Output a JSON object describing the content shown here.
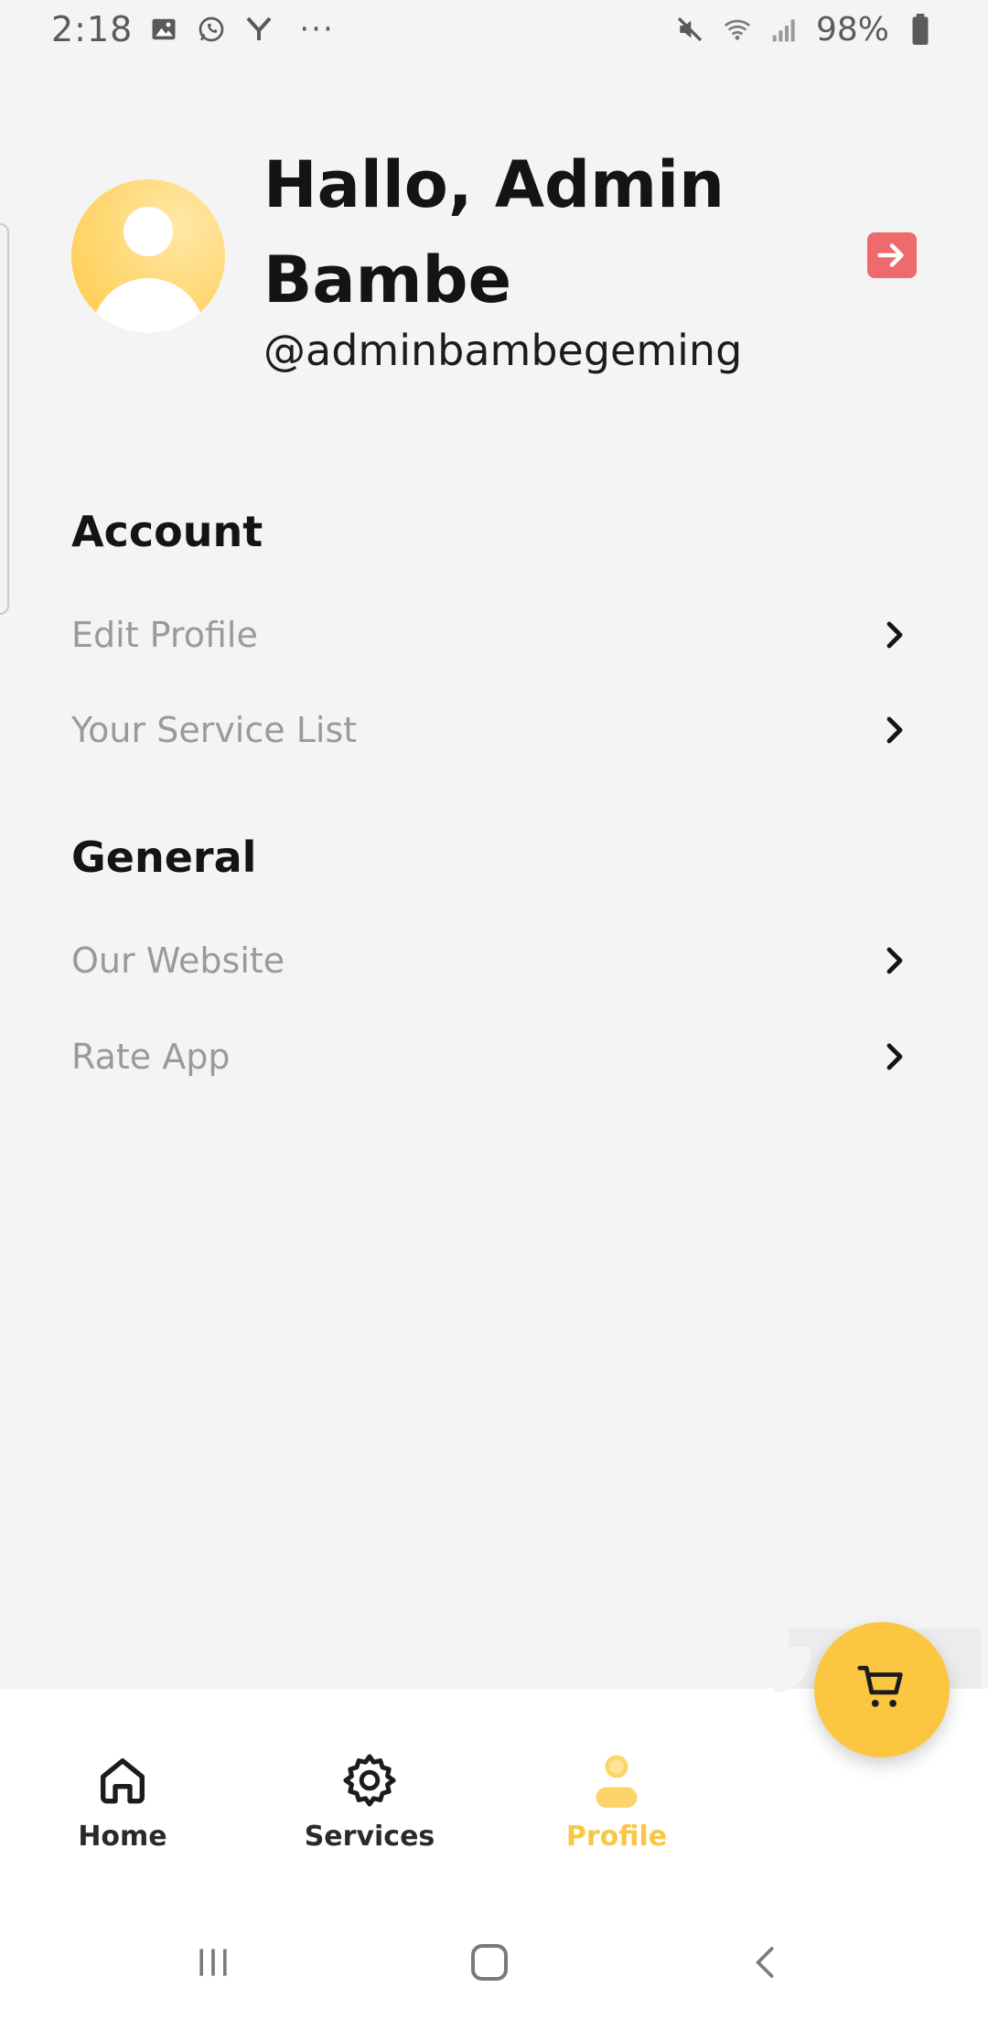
{
  "status_bar": {
    "time": "2:18",
    "left_icons": [
      "image-icon",
      "whatsapp-icon",
      "y-app-icon"
    ],
    "more": "···",
    "right_icons": [
      "mute-icon",
      "wifi-icon",
      "signal-icon"
    ],
    "battery": "98%"
  },
  "profile": {
    "greeting": "Hallo, Admin Bambe",
    "username": "@adminbambegeming",
    "accent_color": "#ffd56a",
    "logout_color": "#ef6a6a"
  },
  "sections": [
    {
      "title": "Account",
      "items": [
        {
          "label": "Edit Profile"
        },
        {
          "label": "Your Service List"
        }
      ]
    },
    {
      "title": "General",
      "items": [
        {
          "label": "Our Website"
        },
        {
          "label": "Rate App"
        }
      ]
    }
  ],
  "bottom_nav": {
    "items": [
      {
        "label": "Home",
        "icon": "home-icon"
      },
      {
        "label": "Services",
        "icon": "gear-icon"
      },
      {
        "label": "Profile",
        "icon": "user-icon",
        "active": true
      }
    ],
    "active_color": "#f7c845",
    "fab_icon": "cart-icon",
    "fab_color": "#fcc640"
  }
}
